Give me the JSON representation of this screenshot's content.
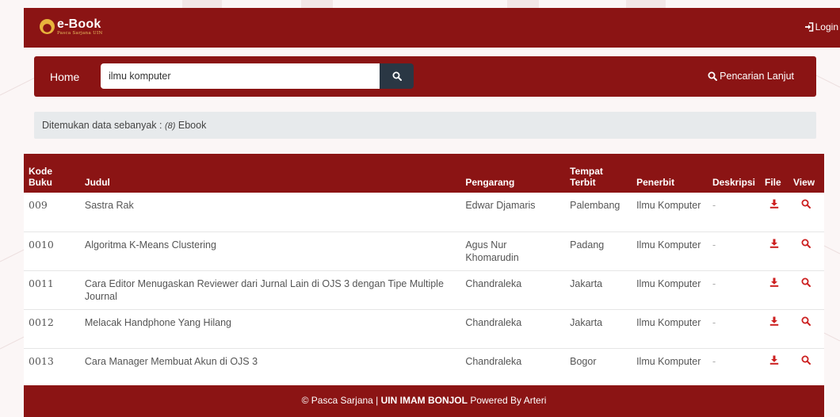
{
  "navbar": {
    "brand_title": "e-Book",
    "brand_subtitle": "Pasca Sarjana UIN",
    "login_label": "Login"
  },
  "searchbar": {
    "home_label": "Home",
    "query": "ilmu komputer",
    "advanced_label": "Pencarian Lanjut"
  },
  "result": {
    "prefix": "Ditemukan data sebanyak : ",
    "count": "(8)",
    "suffix": " Ebook"
  },
  "table": {
    "headers": {
      "kode": "Kode Buku",
      "judul": "Judul",
      "pengarang": "Pengarang",
      "tempat": "Tempat Terbit",
      "penerbit": "Penerbit",
      "deskripsi": "Deskripsi",
      "file": "File",
      "view": "View"
    },
    "rows": [
      {
        "kode": "009",
        "judul": "Sastra Rak",
        "pengarang": "Edwar Djamaris",
        "tempat": "Palembang",
        "penerbit": "Ilmu Komputer",
        "deskripsi": "-"
      },
      {
        "kode": "0010",
        "judul": "Algoritma K-Means Clustering",
        "pengarang": "Agus Nur Khomarudin",
        "tempat": "Padang",
        "penerbit": "Ilmu Komputer",
        "deskripsi": "-"
      },
      {
        "kode": "0011",
        "judul": "Cara Editor Menugaskan Reviewer dari Jurnal Lain di OJS 3 dengan Tipe Multiple Journal",
        "pengarang": "Chandraleka",
        "tempat": "Jakarta",
        "penerbit": "Ilmu Komputer",
        "deskripsi": "-"
      },
      {
        "kode": "0012",
        "judul": "Melacak Handphone Yang Hilang",
        "pengarang": "Chandraleka",
        "tempat": "Jakarta",
        "penerbit": "Ilmu Komputer",
        "deskripsi": "-"
      },
      {
        "kode": "0013",
        "judul": "Cara Manager Membuat Akun di OJS 3",
        "pengarang": "Chandraleka",
        "tempat": "Bogor",
        "penerbit": "Ilmu Komputer",
        "deskripsi": "-"
      }
    ]
  },
  "footer": {
    "prefix": "© Pasca Sarjana | ",
    "institution": "UIN IMAM BONJOL",
    "suffix": " Powered By Arteri"
  },
  "icons": {
    "login": "sign-in-icon",
    "search": "search-icon",
    "download": "download-icon",
    "view": "magnifier-icon"
  },
  "colors": {
    "primary": "#8b1414",
    "search_button": "#2a3744",
    "info_bar": "#e7eaec",
    "icon_red": "#cc1f1f"
  }
}
